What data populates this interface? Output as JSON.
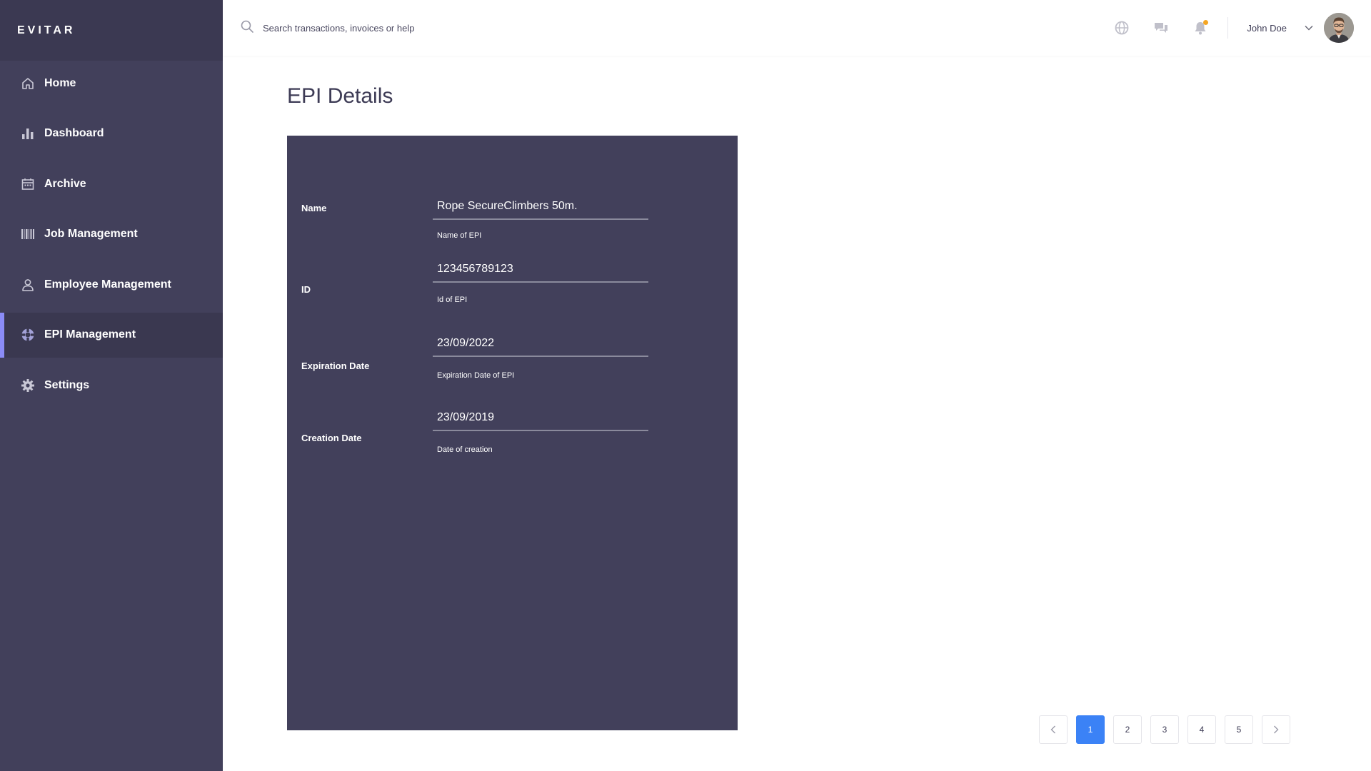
{
  "brand": {
    "name": "EVITAR"
  },
  "sidebar": {
    "items": [
      {
        "label": "Home",
        "icon": "home-icon",
        "active": false
      },
      {
        "label": "Dashboard",
        "icon": "bar-chart-icon",
        "active": false
      },
      {
        "label": "Archive",
        "icon": "calendar-icon",
        "active": false
      },
      {
        "label": "Job Management",
        "icon": "barcode-icon",
        "active": false
      },
      {
        "label": "Employee Management",
        "icon": "user-icon",
        "active": false
      },
      {
        "label": "EPI Management",
        "icon": "lifebuoy-icon",
        "active": true
      },
      {
        "label": "Settings",
        "icon": "gear-icon",
        "active": false
      }
    ]
  },
  "topbar": {
    "search_placeholder": "Search transactions, invoices or help",
    "username": "John Doe",
    "icons": [
      "globe-icon",
      "chat-icon",
      "bell-icon"
    ]
  },
  "page": {
    "title": "EPI Details"
  },
  "details": {
    "name": {
      "label": "Name",
      "value": "Rope SecureClimbers 50m.",
      "help": "Name of  EPI"
    },
    "id": {
      "label": "ID",
      "value": "123456789123",
      "help": "Id of EPI"
    },
    "expiration": {
      "label": "Expiration Date",
      "value": "23/09/2022",
      "help": "Expiration Date of EPI"
    },
    "creation": {
      "label": "Creation Date",
      "value": "23/09/2019",
      "help": "Date of creation"
    }
  },
  "pagination": {
    "pages": [
      "1",
      "2",
      "3",
      "4",
      "5"
    ],
    "current": "1"
  },
  "colors": {
    "sidebar_bg": "#42405b",
    "brand_bg": "#3b3952",
    "active_accent": "#8b8cf7",
    "card_bg": "#42405b",
    "pagination_active": "#3b82f6",
    "notification_dot": "#f5a623"
  }
}
